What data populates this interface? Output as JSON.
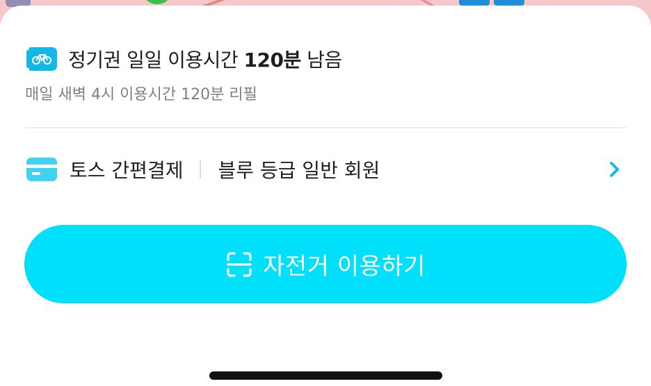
{
  "pass": {
    "title_prefix": "정기권 일일 이용시간 ",
    "remaining": "120분",
    "title_suffix": " 남음",
    "subtitle": "매일 새벽 4시 이용시간 120분 리필",
    "icon": "bike-icon"
  },
  "payment": {
    "method": "토스 간편결제",
    "grade": "블루 등급 일반 회원",
    "icon": "credit-card-icon",
    "chevron_icon": "chevron-right-icon"
  },
  "action": {
    "label": "자전거 이용하기",
    "icon": "qr-scan-icon"
  },
  "colors": {
    "accent": "#00e0fb",
    "badge": "#14b8e6",
    "chevron": "#14b8e6",
    "subtext": "#7b7f87",
    "text": "#1e1e1e"
  }
}
